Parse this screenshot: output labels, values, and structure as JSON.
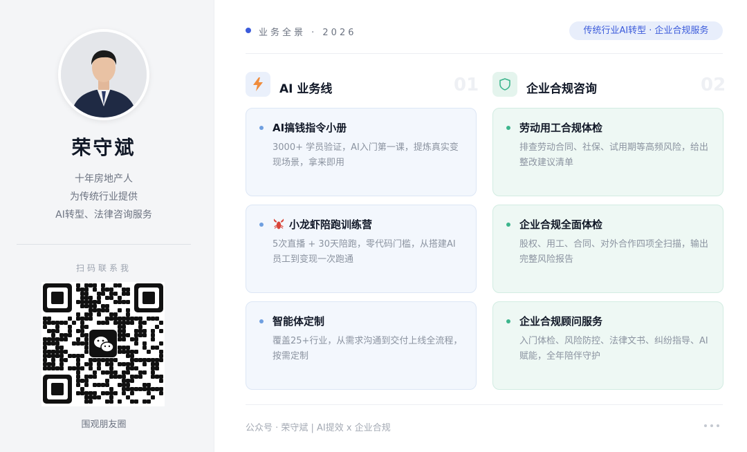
{
  "profile": {
    "name": "荣守斌",
    "bio_lines": [
      "十年房地产人",
      "为传统行业提供",
      "AI转型、法律咨询服务"
    ],
    "scan_label": "扫码联系我",
    "qr_caption": "围观朋友圈"
  },
  "header": {
    "label": "业务全景 · 2026",
    "tag": "传统行业AI转型 · 企业合规服务"
  },
  "columns": [
    {
      "title": "AI 业务线",
      "number": "01",
      "icon": "lightning-icon",
      "accent": "#f08c3c",
      "cards": [
        {
          "title": "AI搞钱指令小册",
          "desc": "3000+ 学员验证，AI入门第一课，提炼真实变现场景，拿来即用"
        },
        {
          "title": "小龙虾陪跑训练营",
          "desc": "5次直播 + 30天陪跑，零代码门槛，从搭建AI员工到变现一次跑通"
        },
        {
          "title": "智能体定制",
          "desc": "覆盖25+行业，从需求沟通到交付上线全流程，按需定制"
        }
      ]
    },
    {
      "title": "企业合规咨询",
      "number": "02",
      "icon": "shield-icon",
      "accent": "#3cb58c",
      "cards": [
        {
          "title": "劳动用工合规体检",
          "desc": "排查劳动合同、社保、试用期等高频风险，给出整改建议清单"
        },
        {
          "title": "企业合规全面体检",
          "desc": "股权、用工、合同、对外合作四项全扫描，输出完整风险报告"
        },
        {
          "title": "企业合规顾问服务",
          "desc": "入门体检、风险防控、法律文书、纠纷指导、AI赋能，全年陪伴守护"
        }
      ]
    }
  ],
  "footer": {
    "text": "公众号 · 荣守斌 | AI提效 x 企业合规"
  },
  "colors": {
    "brand_blue": "#3b5bdb",
    "card_blue_bg": "#f3f7fd",
    "card_green_bg": "#eef8f4"
  }
}
